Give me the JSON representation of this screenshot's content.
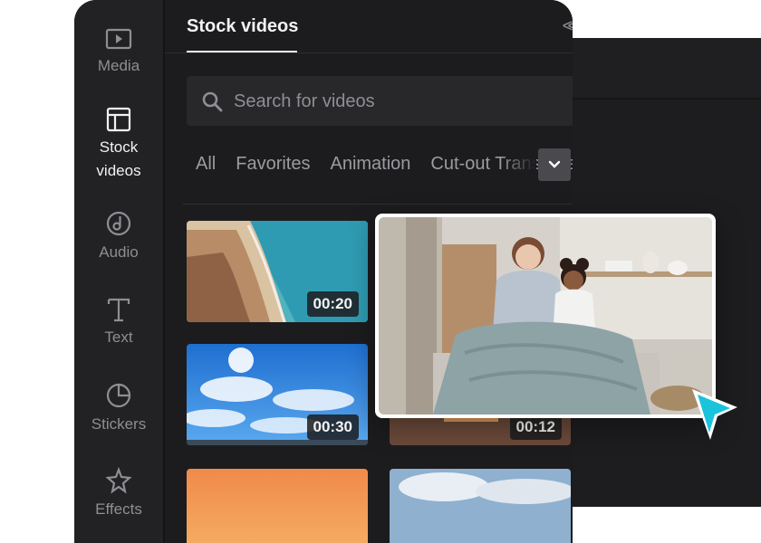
{
  "sidebar": {
    "items": [
      {
        "label": "Media",
        "icon": "media-icon"
      },
      {
        "label": "Stock videos",
        "icon": "stock-videos-icon",
        "active": true
      },
      {
        "label": "Audio",
        "icon": "audio-icon"
      },
      {
        "label": "Text",
        "icon": "text-icon"
      },
      {
        "label": "Stickers",
        "icon": "stickers-icon"
      },
      {
        "label": "Effects",
        "icon": "effects-icon"
      }
    ]
  },
  "panel": {
    "tab_label": "Stock videos",
    "collapse_label": "<<",
    "search_placeholder": "Search for videos",
    "categories": [
      "All",
      "Favorites",
      "Animation",
      "Cut-out Transparent"
    ]
  },
  "videos": [
    {
      "duration": "00:20",
      "scene": "beach-cliffs"
    },
    {
      "duration": "00:30",
      "scene": "blue-sky-clouds"
    },
    {
      "duration": "00:12",
      "scene": "sunset-sea"
    },
    {
      "duration": "",
      "scene": "orange-sky"
    },
    {
      "duration": "",
      "scene": "cloudy-sky"
    }
  ],
  "preview": {
    "scene": "mother-daughter-reading"
  },
  "colors": {
    "accent_cursor": "#19c3dc",
    "panel_bg": "#1c1c1e",
    "rail_bg": "#222224"
  }
}
